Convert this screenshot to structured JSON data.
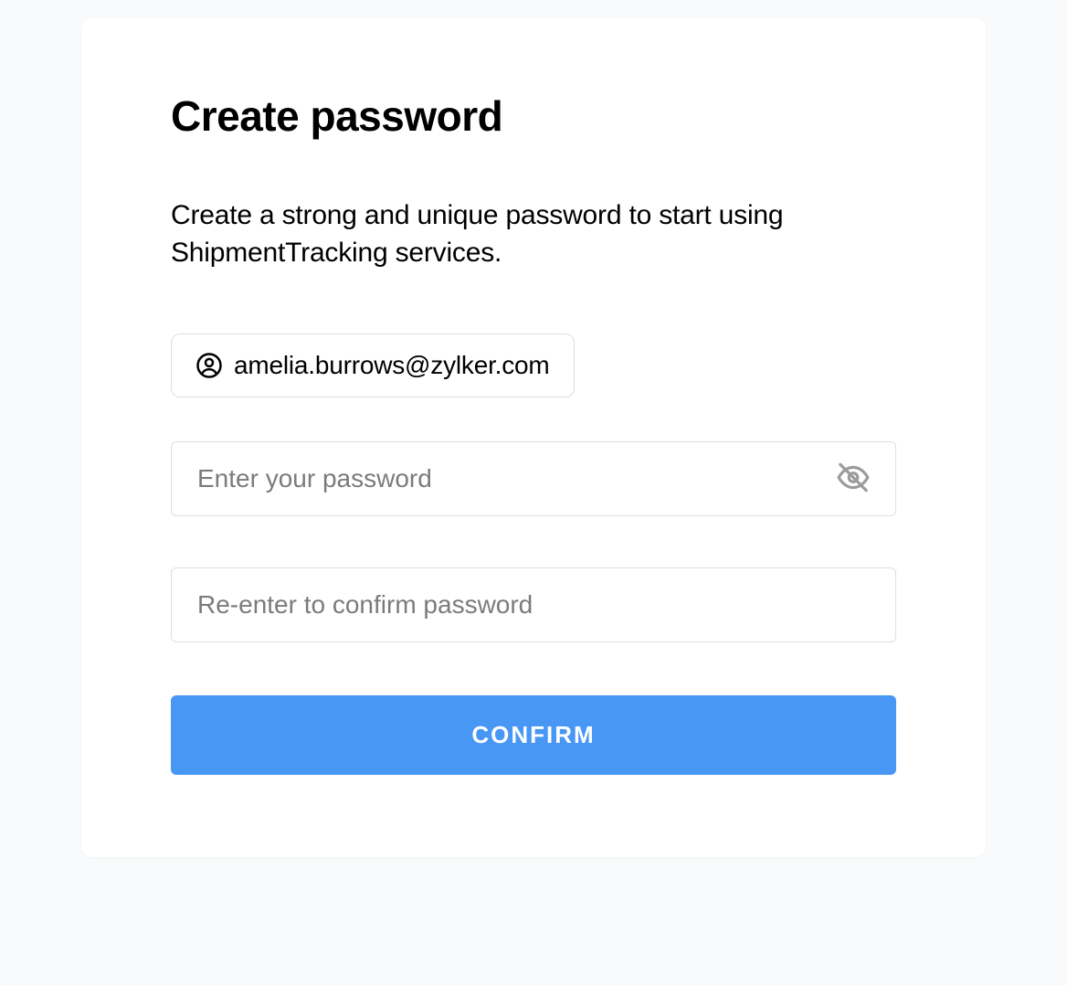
{
  "title": "Create password",
  "subtitle": "Create a strong and unique password to start using ShipmentTracking services.",
  "email": "amelia.burrows@zylker.com",
  "password": {
    "placeholder": "Enter your password",
    "value": ""
  },
  "confirm_password": {
    "placeholder": "Re-enter to confirm password",
    "value": ""
  },
  "confirm_button_label": "CONFIRM",
  "icons": {
    "user": "user-circle-icon",
    "eye_off": "eye-off-icon"
  },
  "colors": {
    "primary": "#4897f5",
    "border": "#dedede",
    "placeholder": "#7b7b7b",
    "background": "#f9fafb"
  }
}
